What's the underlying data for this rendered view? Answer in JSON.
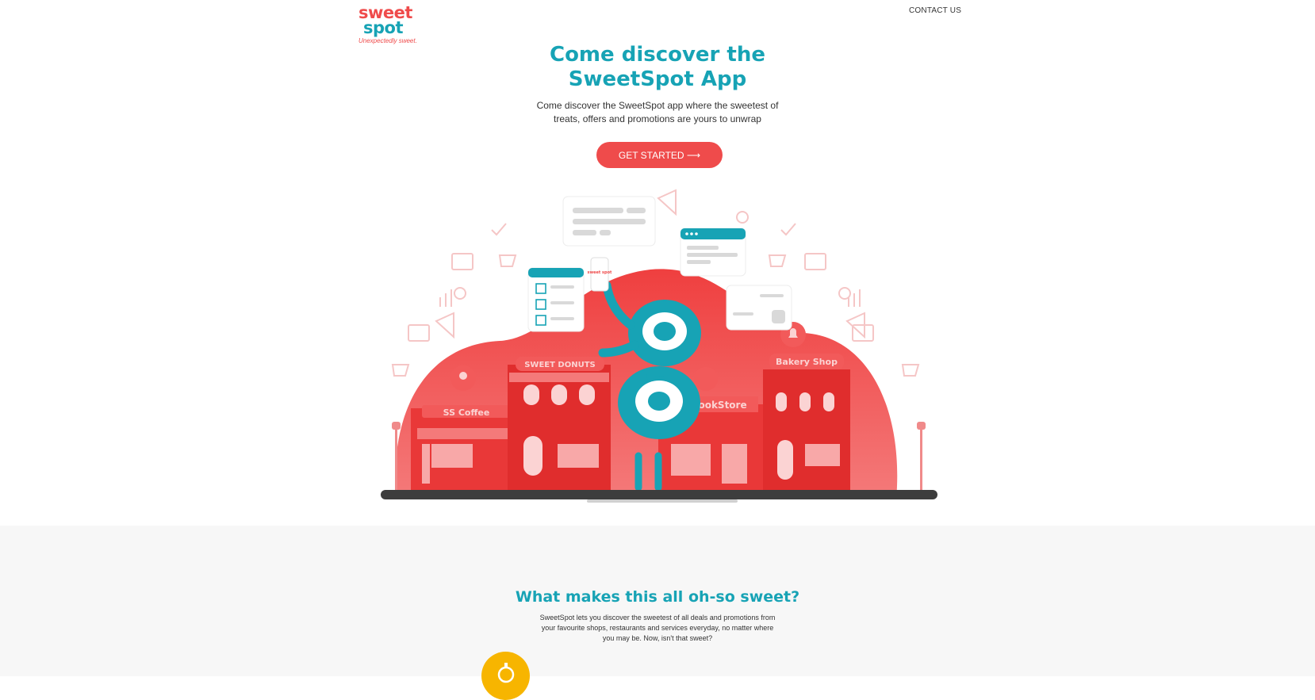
{
  "header": {
    "logo": {
      "line1": "sweet",
      "line2": "spot",
      "tagline": "Unexpectedly sweet."
    },
    "nav": {
      "contact": "CONTACT US"
    }
  },
  "hero": {
    "title_line1": "Come discover the",
    "title_line2": "SweetSpot App",
    "subtitle": "Come discover the SweetSpot app where the sweetest of treats, offers and promotions are yours to unwrap",
    "cta_label": "GET STARTED ⟶"
  },
  "illustration": {
    "shop_signs": [
      "SS Coffee",
      "SWEET DONUTS",
      "SS BookStore",
      "Bakery Shop"
    ],
    "phone_text": "sweet spot"
  },
  "section2": {
    "title": "What makes this all oh-so sweet?",
    "body": "SweetSpot lets you discover the sweetest of all deals and promotions from your favourite shops, restaurants and services everyday, no matter where you may be. Now, isn't that sweet?"
  },
  "colors": {
    "brand_red": "#ef4b4b",
    "brand_teal": "#17a3b5",
    "accent_yellow": "#f7b500"
  }
}
